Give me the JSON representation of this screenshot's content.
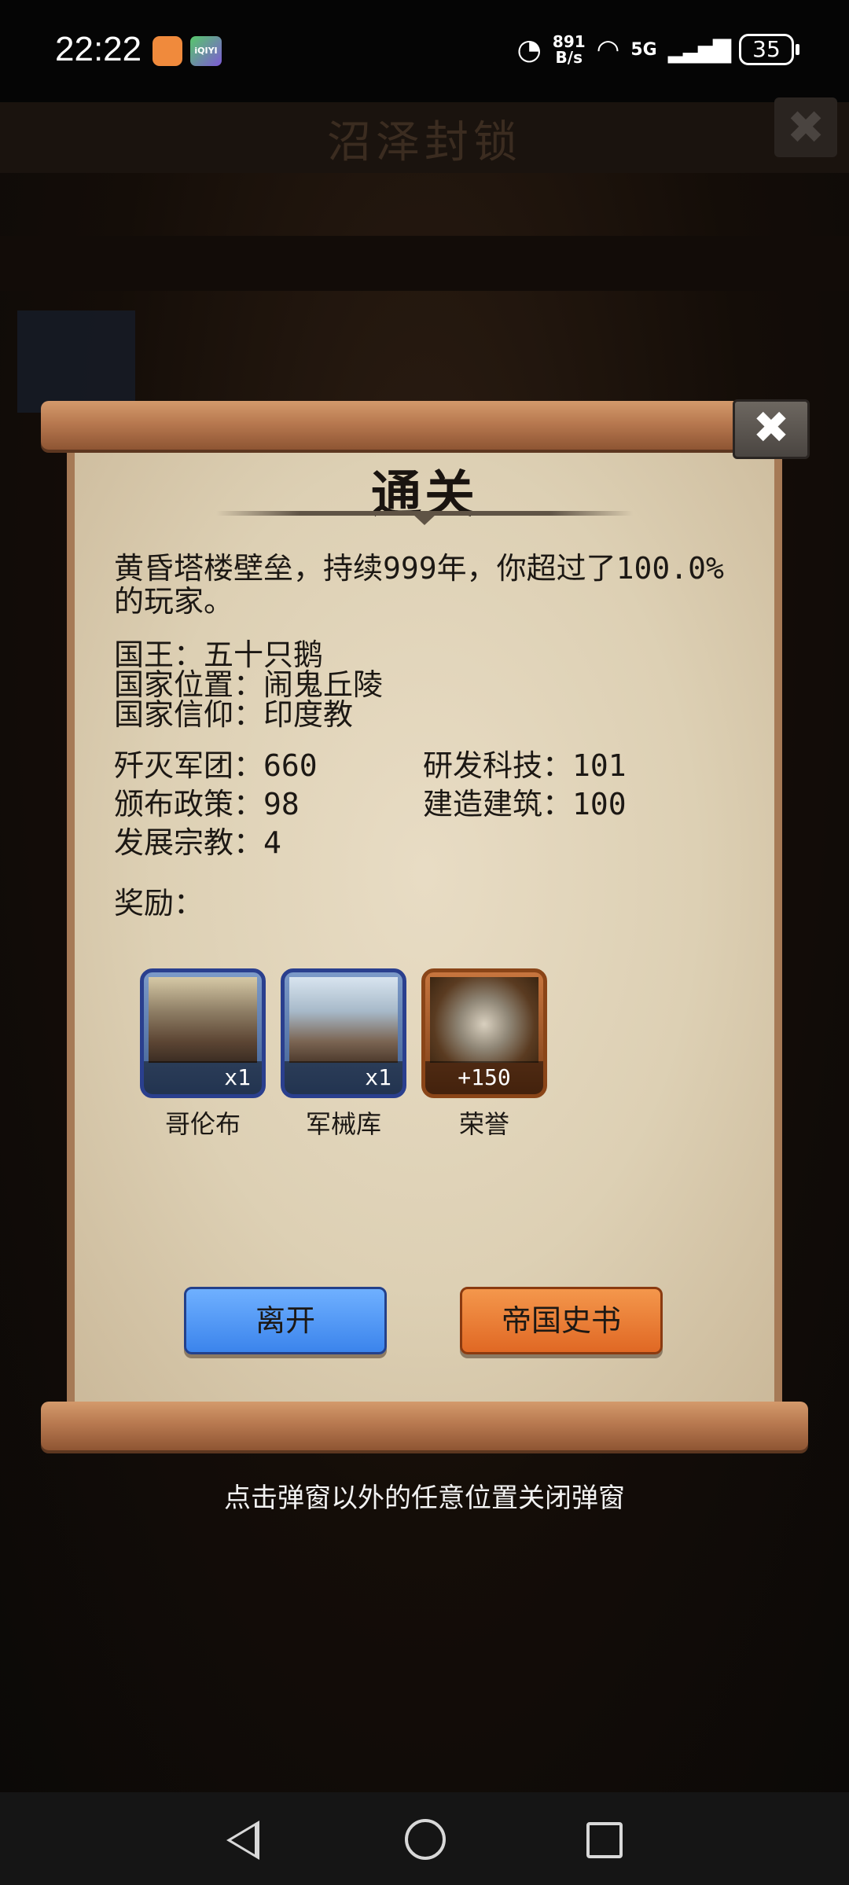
{
  "status_bar": {
    "time": "22:22",
    "app_icon_2_label": "iQIYI",
    "speed_value": "891",
    "speed_unit": "B/s",
    "network": "5G",
    "battery": "35"
  },
  "background": {
    "title": "沼泽封锁",
    "close_glyph": "✖"
  },
  "dialog": {
    "title": "通关",
    "close_glyph": "✖",
    "summary": "黄昏塔楼壁垒，持续999年，你超过了100.0%的玩家。",
    "info": [
      "国王：五十只鹅",
      "国家位置：闹鬼丘陵",
      "国家信仰：印度教"
    ],
    "stats_left": [
      "歼灭军团：660",
      "颁布政策：98",
      "发展宗教：4"
    ],
    "stats_right": [
      "研发科技：101",
      "建造建筑：100"
    ],
    "rewards_label": "奖励：",
    "rewards": [
      {
        "name": "哥伦布",
        "count": "x1",
        "icon": "portrait-columbus-icon"
      },
      {
        "name": "军械库",
        "count": "x1",
        "icon": "armory-tower-icon"
      },
      {
        "name": "荣誉",
        "count": "+150",
        "icon": "honor-medal-icon"
      }
    ],
    "buttons": {
      "leave": "离开",
      "history": "帝国史书"
    }
  },
  "hint": "点击弹窗以外的任意位置关闭弹窗",
  "colors": {
    "leave_button": "#4a93f5",
    "history_button": "#ec7a34",
    "scroll_paper": "#e0d3b8",
    "scroll_rod": "#b87950"
  }
}
